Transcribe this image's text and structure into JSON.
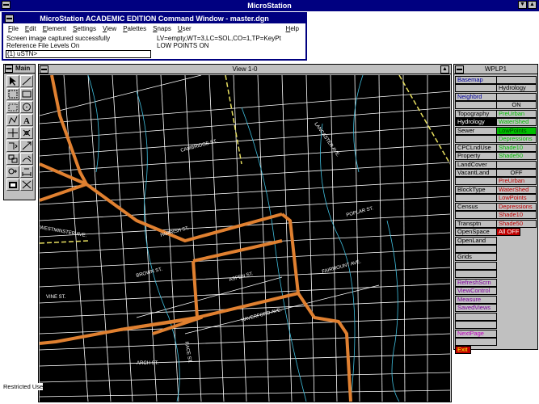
{
  "app": {
    "title": "MicroStation"
  },
  "command_window": {
    "title": "MicroStation ACADEMIC EDITION Command Window - master.dgn",
    "menu": [
      "File",
      "Edit",
      "Element",
      "Settings",
      "View",
      "Palettes",
      "Snaps",
      "User",
      "Help"
    ],
    "status_left_1": "Screen image captured successfully",
    "status_left_2": "Reference File Levels On",
    "status_right_1": "LV=empty,WT=3,LC=SOL,CO=1,TP=KeyPt",
    "status_right_2": "LOW POINTS ON",
    "prompt": "(1) uSTN>"
  },
  "main_palette": {
    "title": "Main"
  },
  "view": {
    "title": "View 1-0"
  },
  "map_streets": [
    "VINE ST.",
    "ARCH ST.",
    "RACE ST.",
    "LANCASTER AVE.",
    "WESTMINSTER AVE.",
    "HAVERFORD AVE.",
    "BROWN ST.",
    "FAIRMOUNT AVE.",
    "ASPEN ST.",
    "PARRISH ST.",
    "POPLAR ST.",
    "CAMBRIDGE ST."
  ],
  "wplp": {
    "title": "WPLP1",
    "left_items": [
      {
        "label": "Basemap",
        "cls": "blue"
      },
      {
        "label": "",
        "cls": ""
      },
      {
        "label": "Neighbrd",
        "cls": "blue"
      },
      {
        "label": "",
        "cls": ""
      },
      {
        "label": "Topography",
        "cls": ""
      },
      {
        "label": "Hydrology",
        "cls": "sel"
      },
      {
        "label": "Sewer",
        "cls": ""
      },
      {
        "label": "",
        "cls": ""
      },
      {
        "label": "CPCLndUse",
        "cls": ""
      },
      {
        "label": "Property",
        "cls": ""
      },
      {
        "label": "LandCover",
        "cls": ""
      },
      {
        "label": "VacantLand",
        "cls": ""
      },
      {
        "label": "",
        "cls": ""
      },
      {
        "label": "BlockType",
        "cls": ""
      },
      {
        "label": "",
        "cls": ""
      },
      {
        "label": "Census",
        "cls": ""
      },
      {
        "label": "",
        "cls": ""
      },
      {
        "label": "Transptn",
        "cls": ""
      },
      {
        "label": "OpenSpace",
        "cls": ""
      },
      {
        "label": "OpenLand",
        "cls": ""
      },
      {
        "label": "",
        "cls": ""
      },
      {
        "label": "Grids",
        "cls": ""
      },
      {
        "label": "",
        "cls": ""
      },
      {
        "label": "",
        "cls": ""
      },
      {
        "label": "RefreshScrn",
        "cls": "purple"
      },
      {
        "label": "ViewControl",
        "cls": "purple"
      },
      {
        "label": "Measure",
        "cls": "purple"
      },
      {
        "label": "SavedViews",
        "cls": "purple"
      },
      {
        "label": "",
        "cls": ""
      },
      {
        "label": "",
        "cls": ""
      },
      {
        "label": "NextPage",
        "cls": "magenta"
      },
      {
        "label": "",
        "cls": ""
      },
      {
        "label": "Exit",
        "cls": "exit"
      }
    ],
    "right_items": [
      {
        "label": "",
        "cls": ""
      },
      {
        "label": "Hydrology",
        "cls": ""
      },
      {
        "label": "",
        "cls": ""
      },
      {
        "label": "ON",
        "cls": "center"
      },
      {
        "label": "PreUrban",
        "cls": "green"
      },
      {
        "label": "WaterShed",
        "cls": "green"
      },
      {
        "label": "LowPoints",
        "cls": "hl-green"
      },
      {
        "label": "Depressions",
        "cls": "green"
      },
      {
        "label": "Shade10",
        "cls": "green"
      },
      {
        "label": "Shade50",
        "cls": "green"
      },
      {
        "label": "",
        "cls": ""
      },
      {
        "label": "OFF",
        "cls": "center"
      },
      {
        "label": "PreUrban",
        "cls": "red"
      },
      {
        "label": "WaterShed",
        "cls": "red"
      },
      {
        "label": "LowPoints",
        "cls": "red"
      },
      {
        "label": "Depressions",
        "cls": "red"
      },
      {
        "label": "Shade10",
        "cls": "red"
      },
      {
        "label": "Shade50",
        "cls": "red"
      },
      {
        "label": "All OFF",
        "cls": "alloff"
      }
    ]
  },
  "status": {
    "restricted": "Restricted Use"
  }
}
